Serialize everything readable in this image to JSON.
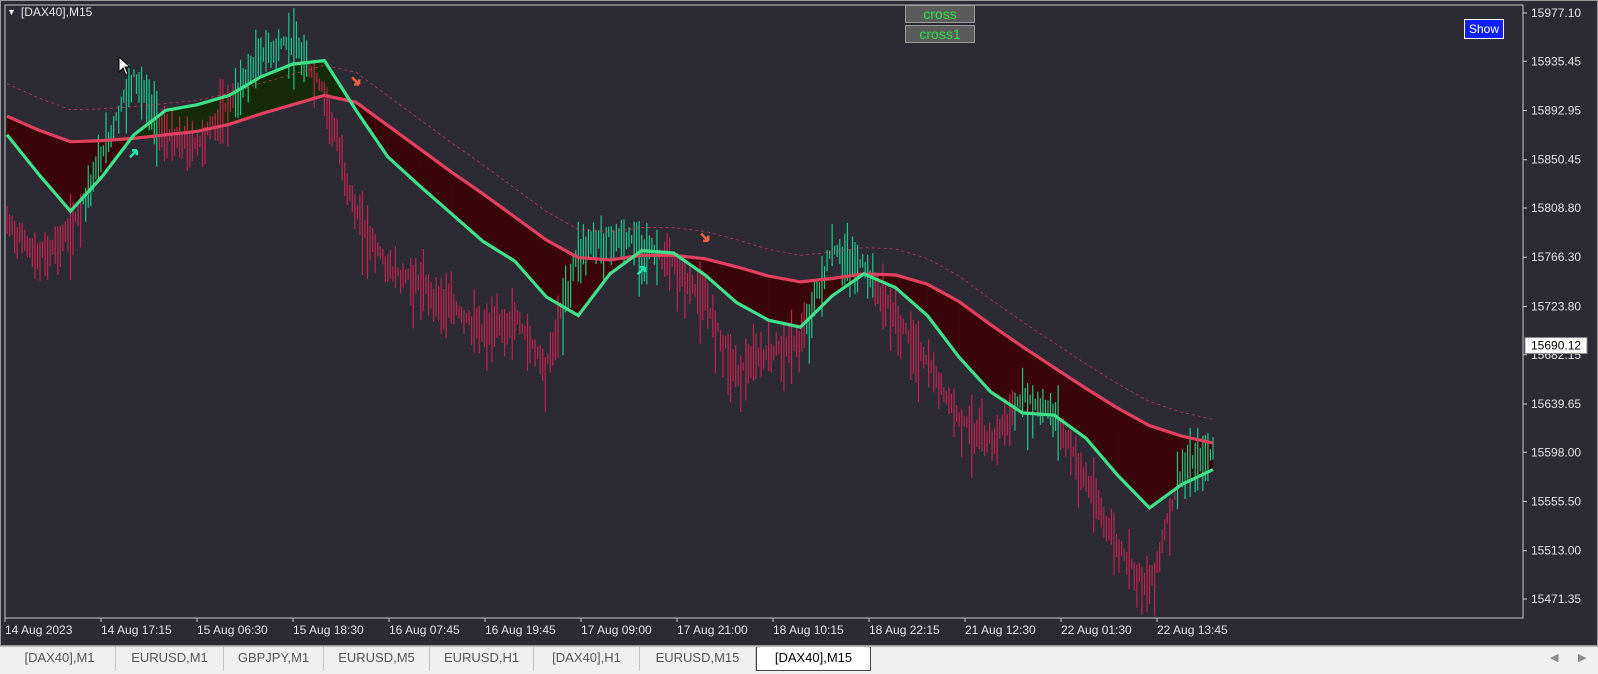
{
  "window": {
    "title": "[DAX40],M15"
  },
  "buttons": {
    "cross": "cross",
    "cross1": "cross1",
    "show": "Show"
  },
  "price_axis": {
    "labels": [
      "15977.10",
      "15935.45",
      "15892.95",
      "15850.45",
      "15808.80",
      "15766.30",
      "15723.80",
      "15682.15",
      "15639.65",
      "15598.00",
      "15555.50",
      "15513.00",
      "15471.35"
    ],
    "current_price": "15690.12"
  },
  "time_axis": {
    "labels": [
      "14 Aug 2023",
      "14 Aug 17:15",
      "15 Aug 06:30",
      "15 Aug 18:30",
      "16 Aug 07:45",
      "16 Aug 19:45",
      "17 Aug 09:00",
      "17 Aug 21:00",
      "18 Aug 10:15",
      "18 Aug 22:15",
      "21 Aug 12:30",
      "22 Aug 01:30",
      "22 Aug 13:45"
    ]
  },
  "tabs": [
    "[DAX40],M1",
    "EURUSD,M1",
    "GBPJPY,M1",
    "EURUSD,M5",
    "EURUSD,H1",
    "[DAX40],H1",
    "EURUSD,M15",
    "[DAX40],M15"
  ],
  "active_tab": "[DAX40],M15",
  "colors": {
    "background": "#2c2a33",
    "bull": "#19c98a",
    "bear": "#c0244f",
    "fast_ma": "#40e08a",
    "slow_ma": "#e24060",
    "fill_bear": "#3a0508",
    "fill_bull": "#142a08",
    "buy_arrow": "#1ee8a6",
    "sell_arrow": "#f06040"
  },
  "icons": {
    "collapse": "triangle-down-icon",
    "pointer": "mouse-pointer-icon",
    "scroll_left": "scroll-left-icon",
    "scroll_right": "scroll-right-icon"
  },
  "chart_data": {
    "type": "line",
    "symbol": "[DAX40]",
    "timeframe": "M15",
    "ylim": [
      15450,
      15990
    ],
    "grid": false,
    "x": [
      0,
      4,
      8,
      12,
      16,
      20,
      24,
      28,
      32,
      36,
      40,
      44,
      48,
      52,
      56,
      60,
      64,
      68,
      72,
      76,
      80,
      84,
      88,
      92,
      96,
      100,
      104,
      108,
      112,
      116,
      120,
      124,
      128,
      132,
      136,
      140,
      144,
      148,
      152
    ],
    "series": [
      {
        "role": "price",
        "values": [
          15800,
          15770,
          15792,
          15860,
          15928,
          15875,
          15868,
          15902,
          15946,
          15956,
          15912,
          15808,
          15760,
          15748,
          15728,
          15706,
          15718,
          15676,
          15778,
          15788,
          15782,
          15762,
          15732,
          15672,
          15688,
          15698,
          15776,
          15762,
          15718,
          15678,
          15632,
          15612,
          15648,
          15636,
          15578,
          15520,
          15486,
          15585,
          15602
        ]
      },
      {
        "role": "fast-ma",
        "values": [
          15872,
          15838,
          15806,
          15836,
          15872,
          15893,
          15898,
          15906,
          15922,
          15933,
          15936,
          15893,
          15853,
          15828,
          15804,
          15780,
          15763,
          15732,
          15716,
          15752,
          15772,
          15770,
          15751,
          15727,
          15712,
          15706,
          15733,
          15752,
          15740,
          15716,
          15680,
          15650,
          15632,
          15630,
          15610,
          15578,
          15550,
          15570,
          15583
        ]
      },
      {
        "role": "slow-ma",
        "values": [
          15888,
          15876,
          15866,
          15867,
          15869,
          15872,
          15875,
          15881,
          15890,
          15898,
          15906,
          15900,
          15880,
          15860,
          15840,
          15821,
          15801,
          15781,
          15766,
          15764,
          15768,
          15768,
          15765,
          15758,
          15750,
          15745,
          15748,
          15752,
          15751,
          15743,
          15728,
          15708,
          15689,
          15671,
          15653,
          15636,
          15621,
          15612,
          15606
        ]
      }
    ]
  }
}
